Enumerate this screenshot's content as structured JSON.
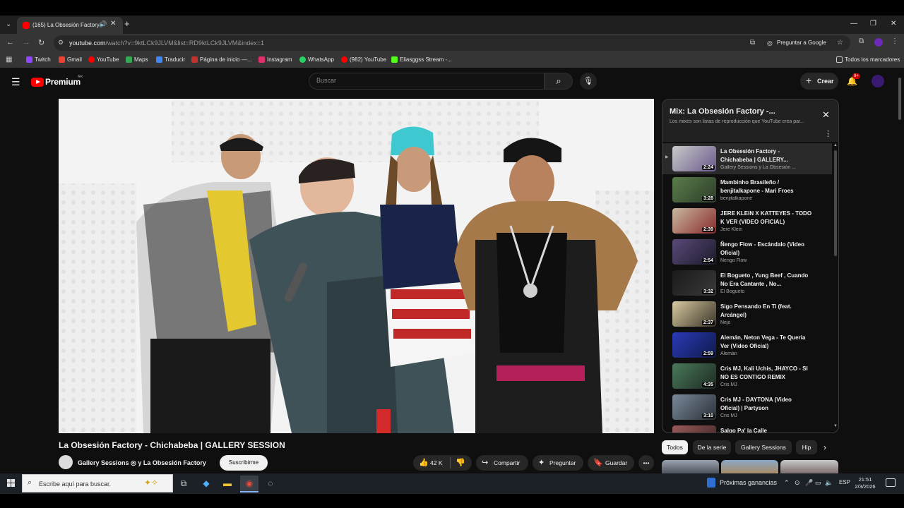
{
  "browser": {
    "tab_title": "(165) La Obsesión Factory",
    "url_domain": "youtube.com",
    "url_rest": "/watch?v=9ktLCk9JLVM&list=RD9ktLCk9JLVM&index=1",
    "ask_google": "Preguntar a Google",
    "bookmarks": [
      "Twitch",
      "Gmail",
      "YouTube",
      "Maps",
      "Traducir",
      "Página de inicio —...",
      "Instagram",
      "WhatsApp",
      "(982) YouTube",
      "Eliasggss Stream -..."
    ],
    "bookmark_colors": [
      "#9146ff",
      "#ea4335",
      "#ff0000",
      "#34a853",
      "#4285f4",
      "#c4302b",
      "#e1306c",
      "#25d366",
      "#ff0000",
      "#53fc18"
    ],
    "all_bookmarks": "Todos los marcadores"
  },
  "youtube": {
    "logo_text": "Premium",
    "logo_region": "AR",
    "search_placeholder": "Buscar",
    "create_label": "Crear",
    "notif_badge": "9+",
    "video_title": "La Obsesión Factory - Chichabeba | GALLERY SESSION",
    "channel": "Gallery Sessions ◎ y La Obsesión Factory",
    "subscribe": "Suscribirme",
    "likes": "42 K",
    "share": "Compartir",
    "ask": "Preguntar",
    "save": "Guardar",
    "mix_title": "Mix: La Obsesión Factory -...",
    "mix_sub": "Los mixes son listas de reproducción que YouTube crea par...",
    "playlist": [
      {
        "title": "La Obsesión Factory - Chichabeba | GALLERY...",
        "channel": "Gallery Sessions y La Obsesión ...",
        "dur": "2:24",
        "colors": [
          "#c9c9c9",
          "#6a5a8c"
        ]
      },
      {
        "title": "Mambinho Brasileño / benjitalkapone - Mari Froes",
        "channel": "benjitalkapone",
        "dur": "3:28",
        "colors": [
          "#5a7d4a",
          "#2d3d2a"
        ]
      },
      {
        "title": "JERE KLEIN X KATTEYES - TODO K VER (VIDEO OFICIAL)",
        "channel": "Jere Klein",
        "dur": "2:39",
        "colors": [
          "#c8b8a0",
          "#8a2a2a"
        ]
      },
      {
        "title": "Ñengo Flow - Escándalo (Video Oficial)",
        "channel": "Ñengo Flow",
        "dur": "2:54",
        "colors": [
          "#5a4a7a",
          "#1d1a2a"
        ]
      },
      {
        "title": "El Bogueto , Yung Beef , Cuando No Era Cantante , No...",
        "channel": "El Bogueto",
        "dur": "3:32",
        "colors": [
          "#1a1a1a",
          "#3a3a3a"
        ]
      },
      {
        "title": "Sigo Pensando En Ti (feat. Arcángel)",
        "channel": "Ñejo",
        "dur": "2:37",
        "colors": [
          "#d8c9a0",
          "#3a3528"
        ]
      },
      {
        "title": "Alemán, Neton Vega - Te Quería Ver (Video Oficial)",
        "channel": "Alemán",
        "dur": "2:59",
        "colors": [
          "#2a3ab8",
          "#101a4a"
        ]
      },
      {
        "title": "Cris MJ, Kali Uchis, JHAYCO - SI NO ES CONTIGO REMIX",
        "channel": "Cris MJ",
        "dur": "4:35",
        "colors": [
          "#4a7a5a",
          "#1d2a22"
        ]
      },
      {
        "title": "Cris MJ - DAYTONA (Video Oficial) | Partyson",
        "channel": "Cris MJ",
        "dur": "3:10",
        "colors": [
          "#7a8a9a",
          "#2a3038"
        ]
      },
      {
        "title": "Salgo Pa' la Calle",
        "channel": "",
        "dur": "",
        "colors": [
          "#9a5a5a",
          "#3a2222"
        ]
      }
    ],
    "chips": [
      "Todos",
      "De la serie",
      "Gallery Sessions",
      "Hip"
    ]
  },
  "taskbar": {
    "search_placeholder": "Escribe aquí para buscar.",
    "news": "Próximas ganancias",
    "lang": "ESP",
    "time": "21:51",
    "date": "2/3/2026"
  }
}
